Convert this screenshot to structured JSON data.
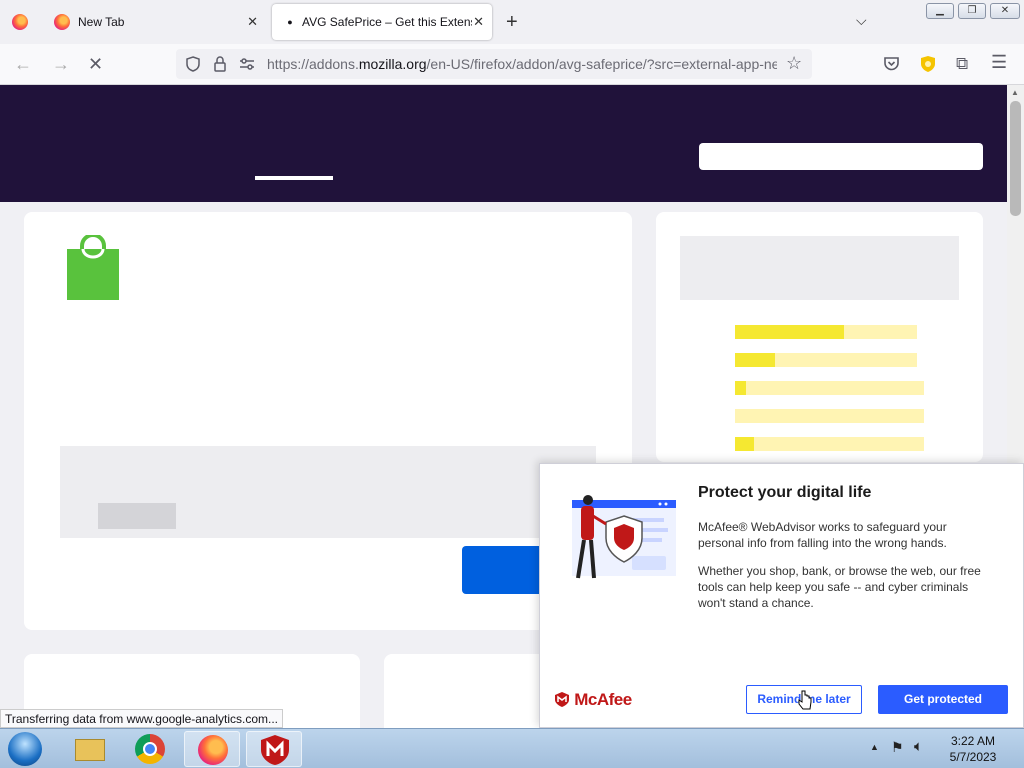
{
  "tabs": [
    {
      "label": "",
      "icon": "firefox-icon"
    },
    {
      "label": "New Tab",
      "icon": "firefox-icon"
    },
    {
      "label": "AVG SafePrice – Get this Extensio",
      "icon": "loading-dot-icon",
      "active": true
    }
  ],
  "url": {
    "prefix": "https://addons.",
    "domain": "mozilla.org",
    "rest": "/en-US/firefox/addon/avg-safeprice/?src=external-app-ne"
  },
  "page": {
    "hero_color": "#20123a",
    "rating_bars": [
      0.6,
      0.22,
      0.06,
      0.0,
      0.1
    ]
  },
  "status_text": "Transferring data from www.google-analytics.com...",
  "popup": {
    "title": "Protect your digital life",
    "para1": "McAfee® WebAdvisor works to safeguard your personal info from falling into the wrong hands.",
    "para2": "Whether you shop, bank, or browse the web, our free tools can help keep you safe -- and cyber criminals won't stand a chance.",
    "brand": "McAfee",
    "remind_label": "Remind me later",
    "cta_label": "Get protected",
    "accent": "#2b5cff",
    "brand_color": "#c01818"
  },
  "taskbar": {
    "time": "3:22 AM",
    "date": "5/7/2023",
    "apps": [
      "start-orb-icon",
      "file-explorer-icon",
      "chrome-icon",
      "firefox-icon",
      "mcafee-icon"
    ]
  }
}
